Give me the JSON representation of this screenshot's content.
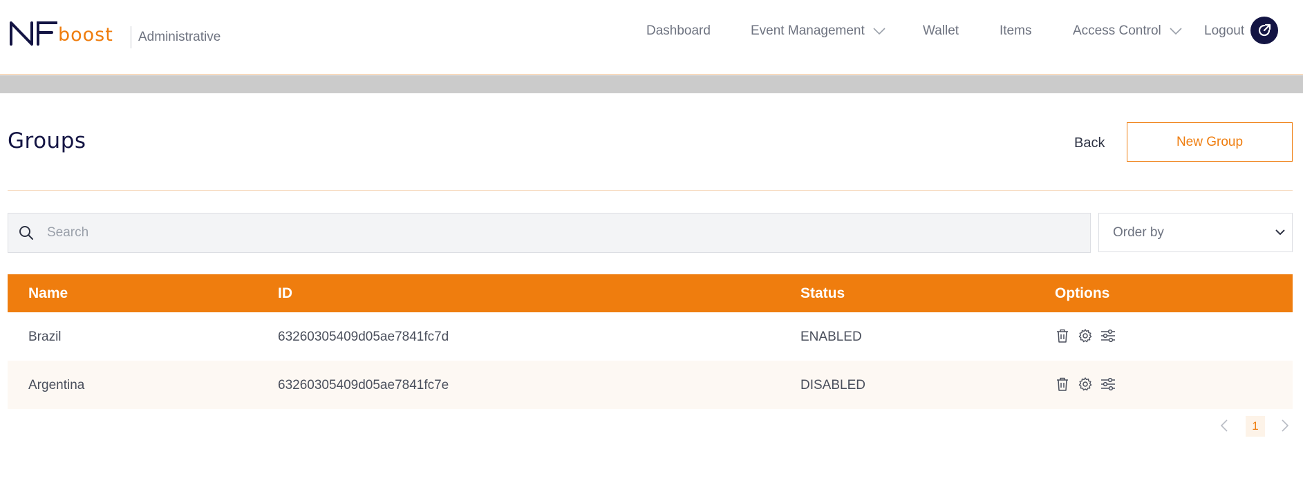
{
  "brand": {
    "logo_text": "NF",
    "logo_suffix": "boost",
    "section": "Administrative",
    "accent_color": "#ef7d0e",
    "navy_color": "#131443"
  },
  "nav": {
    "dashboard": "Dashboard",
    "event_management": "Event Management",
    "wallet": "Wallet",
    "items": "Items",
    "access_control": "Access Control",
    "logout": "Logout"
  },
  "page": {
    "title": "Groups",
    "back_label": "Back",
    "new_group_label": "New Group"
  },
  "search": {
    "placeholder": "Search",
    "value": ""
  },
  "order_by": {
    "label": "Order by"
  },
  "table": {
    "headers": {
      "name": "Name",
      "id": "ID",
      "status": "Status",
      "options": "Options"
    },
    "rows": [
      {
        "name": "Brazil",
        "id": "63260305409d05ae7841fc7d",
        "status": "ENABLED"
      },
      {
        "name": "Argentina",
        "id": "63260305409d05ae7841fc7e",
        "status": "DISABLED"
      }
    ],
    "row_icons": [
      "trash-icon",
      "gear-icon",
      "sliders-icon"
    ]
  },
  "pagination": {
    "current_page": "1"
  }
}
